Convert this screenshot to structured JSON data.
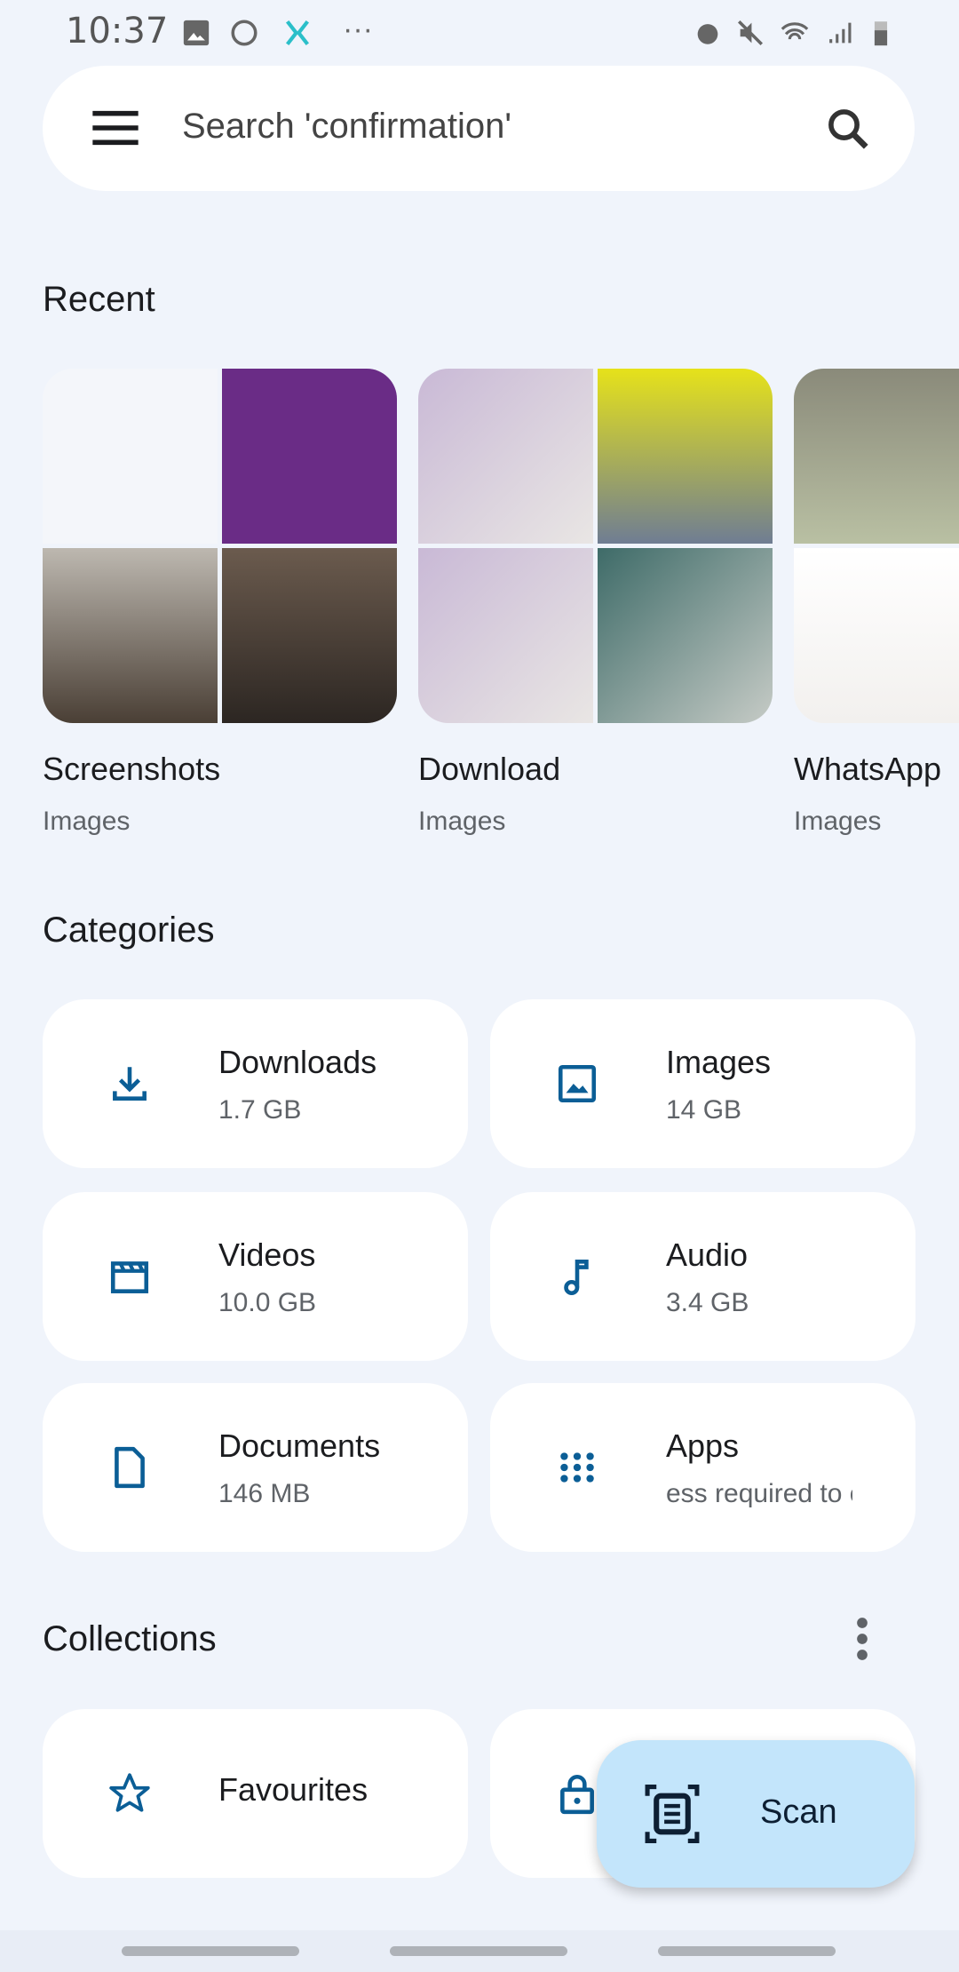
{
  "status_bar": {
    "time": "10:37",
    "notification_icons": [
      "image-icon",
      "whatsapp-icon",
      "x-app-icon",
      "more-icon"
    ],
    "system_icons": [
      "alarm-icon",
      "mute-icon",
      "wifi-icon",
      "signal-icon",
      "battery-icon"
    ]
  },
  "search": {
    "placeholder": "Search 'confirmation'"
  },
  "recent": {
    "title": "Recent",
    "items": [
      {
        "name": "Screenshots",
        "type": "Images"
      },
      {
        "name": "Download",
        "type": "Images"
      },
      {
        "name": "WhatsApp",
        "type": "Images"
      }
    ]
  },
  "categories": {
    "title": "Categories",
    "items": [
      {
        "label": "Downloads",
        "sub": "1.7 GB",
        "icon": "download-icon"
      },
      {
        "label": "Images",
        "sub": "14 GB",
        "icon": "image-icon"
      },
      {
        "label": "Videos",
        "sub": "10.0 GB",
        "icon": "video-icon"
      },
      {
        "label": "Audio",
        "sub": "3.4 GB",
        "icon": "music-note-icon"
      },
      {
        "label": "Documents",
        "sub": "146 MB",
        "icon": "document-icon"
      },
      {
        "label": "Apps",
        "sub": "ess required to c",
        "icon": "apps-grid-icon"
      }
    ]
  },
  "collections": {
    "title": "Collections",
    "items": [
      {
        "label": "Favourites",
        "icon": "star-icon"
      },
      {
        "label": "",
        "icon": "lock-icon"
      }
    ]
  },
  "fab": {
    "label": "Scan"
  },
  "colors": {
    "accent": "#0b5e96",
    "background": "#f0f4fb",
    "fab": "#c3e5fb"
  }
}
